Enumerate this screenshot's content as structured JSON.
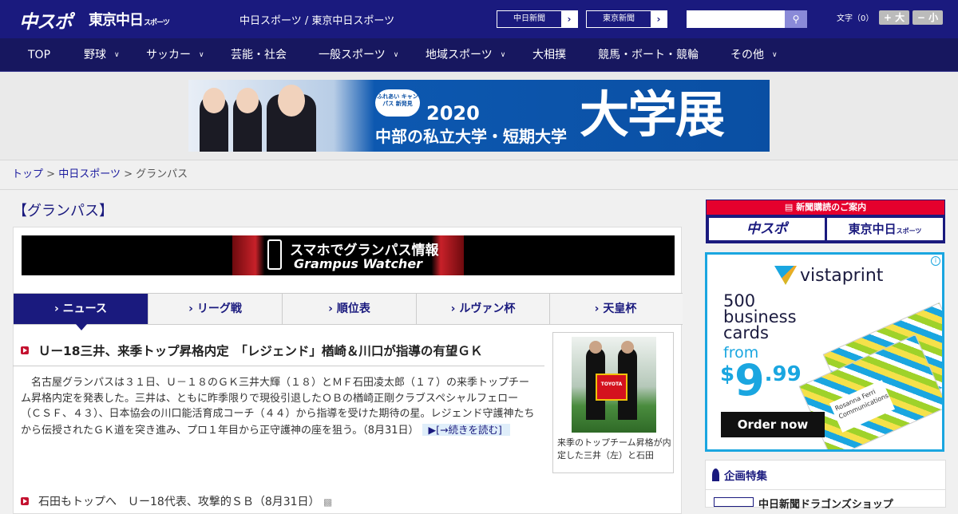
{
  "header": {
    "logo_chuspo": "中スポ",
    "logo_tokyo": "東京中日",
    "logo_tokyo_sub": "スポーツ",
    "site_name": "中日スポーツ / 東京中日スポーツ",
    "link_chunichi": "中日新聞",
    "link_tokyo": "東京新聞",
    "search_placeholder": "",
    "font_size_label": "文字（0）",
    "font_larger": "+ 大",
    "font_smaller": "− 小"
  },
  "nav": [
    {
      "label": "TOP"
    },
    {
      "label": "野球",
      "dropdown": true
    },
    {
      "label": "サッカー",
      "dropdown": true
    },
    {
      "label": "芸能・社会"
    },
    {
      "label": "一般スポーツ",
      "dropdown": true
    },
    {
      "label": "地域スポーツ",
      "dropdown": true
    },
    {
      "label": "大相撲"
    },
    {
      "label": "競馬・ボート・競輪"
    },
    {
      "label": "その他",
      "dropdown": true
    }
  ],
  "banner_ad": {
    "badge": "ふれあい キャンパス 新発見",
    "year": "2020",
    "subtitle": "中部の私立大学・短期大学",
    "big": "大学展"
  },
  "breadcrumb": {
    "top": "トップ",
    "sep": ">",
    "chunichi": "中日スポーツ",
    "current": "グランパス"
  },
  "page_title": "【グランパス】",
  "grampus_banner": {
    "line1": "スマホでグランパス情報",
    "line2": "Grampus Watcher"
  },
  "tabs": [
    "ニュース",
    "リーグ戦",
    "順位表",
    "ルヴァン杯",
    "天皇杯"
  ],
  "tab_prefix": "›",
  "article": {
    "headline": "Ｕー18三井、来季トップ昇格内定　「レジェンド」楢崎＆川口が指導の有望ＧＫ",
    "summary": "　名古屋グランパスは３１日、Ｕ－１８のＧＫ三井大輝（１８）とＭＦ石田凌太郎（１７）の来季トップチーム昇格内定を発表した。三井は、ともに昨季限りで現役引退したＯＢの楢崎正剛クラブスペシャルフェロー（ＣＳＦ、４３）、日本協会の川口能活育成コーチ（４４）から指導を受けた期待の星。レジェンド守護神たちから伝授されたＧＫ道を突き進み、プロ１年目から正守護神の座を狙う。（8月31日）",
    "more": "▶[→続きを読む]",
    "photo_caption": "来季のトップチーム昇格が内定した三井（左）と石田",
    "photo_shirt_text": "TOYOTA"
  },
  "next_item": "石田もトップへ　Ｕー18代表、攻撃的ＳＢ（8月31日）",
  "subscribe": {
    "title": "新聞購読のご案内",
    "chuspo": "中スポ",
    "tokyo": "東京中日",
    "tokyo_sub": "スポーツ"
  },
  "vistaprint_ad": {
    "brand": "vistaprint",
    "headline": "500 business cards",
    "from": "from",
    "price_dollar": "$",
    "price_main": "9",
    "price_cents": ".99",
    "cta": "Order now",
    "card_name": "Rosanna Ferri",
    "card_title": "Communications",
    "info": "i"
  },
  "feature": {
    "title": "企画特集",
    "first_item": "中日新聞ドラゴンズショップ"
  },
  "colors": {
    "brand": "#1a1a7e",
    "nav": "#17175f",
    "accent_red": "#c41230",
    "vistaprint_blue": "#1aa6e0"
  }
}
